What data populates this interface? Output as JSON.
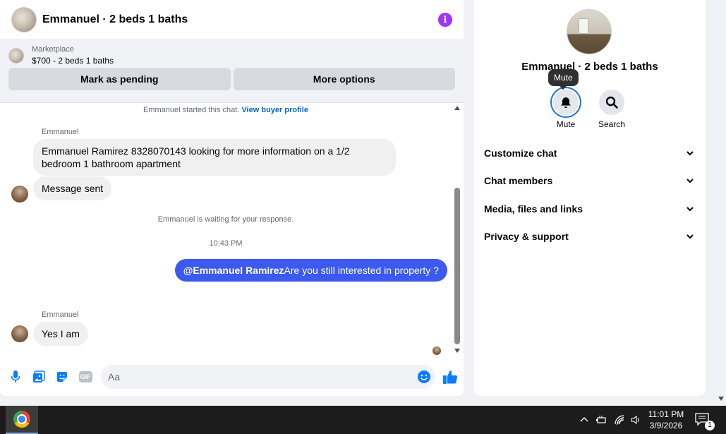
{
  "chat": {
    "title": "Emmanuel · 2 beds 1 baths",
    "marketplace_label": "Marketplace",
    "listing": "$700 - 2 beds 1 baths",
    "mark_pending_label": "Mark as pending",
    "more_options_label": "More options"
  },
  "messages": {
    "started_text": "Emmanuel started this chat.",
    "view_profile_label": "View buyer profile",
    "sender_1": "Emmanuel",
    "msg_1": "Emmanuel Ramirez 8328070143 looking for more information on a 1/2 bedroom 1 bathroom apartment",
    "msg_2": "Message sent",
    "waiting_text": "Emmanuel is waiting for your response.",
    "time_1": "10:43 PM",
    "out_mention": "@Emmanuel Ramirez",
    "out_text": "Are you still interested in property ?",
    "sender_2": "Emmanuel",
    "msg_3": "Yes I am"
  },
  "composer": {
    "placeholder": "Aa"
  },
  "info": {
    "name": "Emmanuel · 2 beds 1 baths",
    "tooltip": "Mute",
    "mute_label": "Mute",
    "search_label": "Search",
    "sections": [
      "Customize chat",
      "Chat members",
      "Media, files and links",
      "Privacy & support"
    ]
  },
  "taskbar": {
    "time": "11:01 PM",
    "date": "3/9/2026",
    "notif_count": "1"
  },
  "colors": {
    "accent": "#3c5af0",
    "link": "#0064d1",
    "info_icon": "#a033ff",
    "icon_blue": "#0a7cff"
  }
}
